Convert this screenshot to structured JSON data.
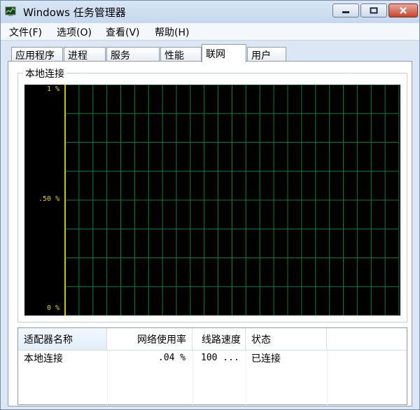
{
  "window": {
    "title": "Windows 任务管理器"
  },
  "menu": {
    "items": [
      "文件(F)",
      "选项(O)",
      "查看(V)",
      "帮助(H)"
    ]
  },
  "tabs": [
    {
      "label": "应用程序",
      "active": false
    },
    {
      "label": "进程",
      "active": false
    },
    {
      "label": "服务",
      "active": false
    },
    {
      "label": "性能",
      "active": false
    },
    {
      "label": "联网",
      "active": true
    },
    {
      "label": "用户",
      "active": false
    }
  ],
  "graph": {
    "group_label": "本地连接",
    "y_labels": {
      "top": "1 %",
      "mid": ".50 %",
      "bottom": "0 %"
    },
    "colors": {
      "background": "#000000",
      "grid": "#008040",
      "label": "#e8d100"
    }
  },
  "list": {
    "columns": [
      "适配器名称",
      "网络使用率",
      "线路速度",
      "状态"
    ],
    "rows": [
      {
        "name": "本地连接",
        "usage": ".04 %",
        "speed": "100 ...",
        "status": "已连接"
      }
    ]
  }
}
